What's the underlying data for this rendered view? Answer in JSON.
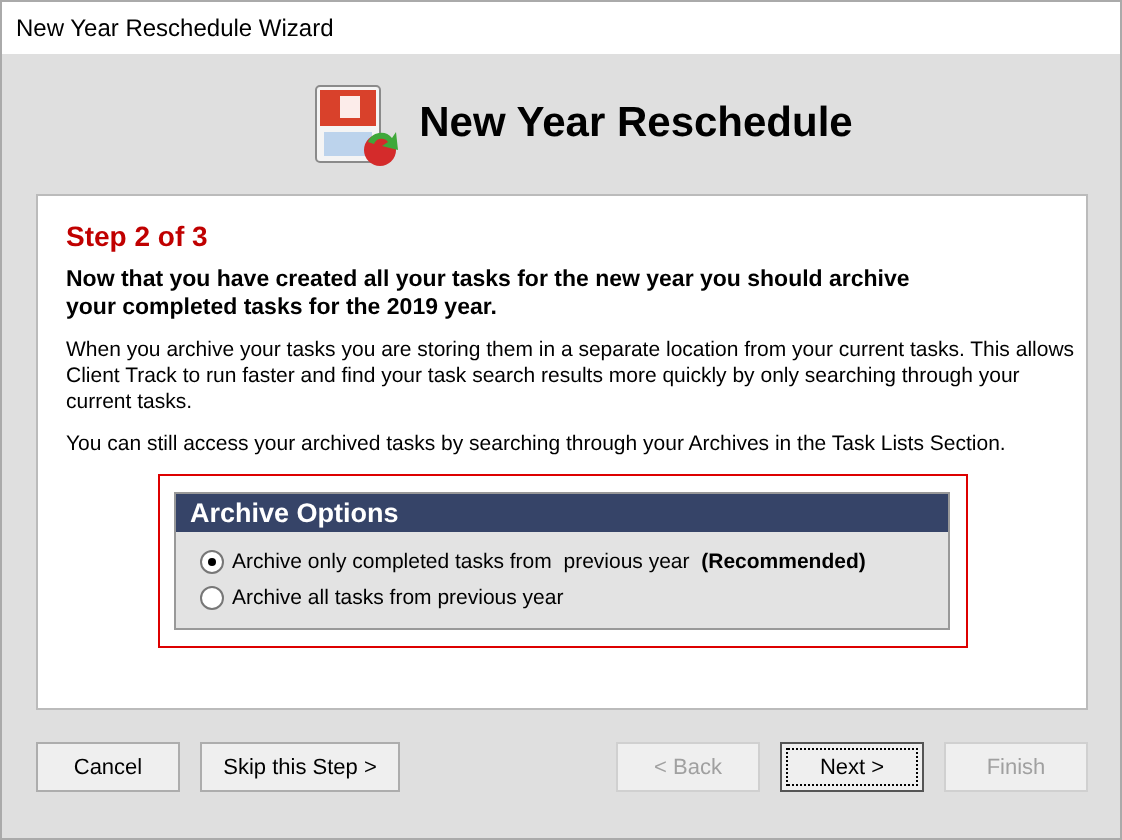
{
  "window": {
    "title": "New Year Reschedule Wizard"
  },
  "header": {
    "title": "New Year Reschedule"
  },
  "step": "Step 2 of 3",
  "intro": "Now that you have created all your tasks for the new year you should archive your completed tasks for the 2019 year.",
  "paragraphs": [
    "When you archive your tasks you are storing them in a separate location from your current tasks. This allows Client Track to run faster and find your task search results more quickly by only searching through your current tasks.",
    "You can still access your archived tasks by searching through your Archives in the Task Lists Section."
  ],
  "archive_options": {
    "title": "Archive Options",
    "options": [
      {
        "label": "Archive only completed tasks from  previous year  **(Recommended)**",
        "selected": true
      },
      {
        "label": "Archive all tasks from previous year",
        "selected": false
      }
    ]
  },
  "buttons": [
    {
      "label": "Cancel",
      "disabled": false,
      "default": false
    },
    {
      "label": "Skip this Step >",
      "disabled": false,
      "default": false
    },
    {
      "label": "< Back",
      "disabled": true,
      "default": false
    },
    {
      "label": "Next >",
      "disabled": false,
      "default": true
    },
    {
      "label": "Finish",
      "disabled": true,
      "default": false
    }
  ]
}
